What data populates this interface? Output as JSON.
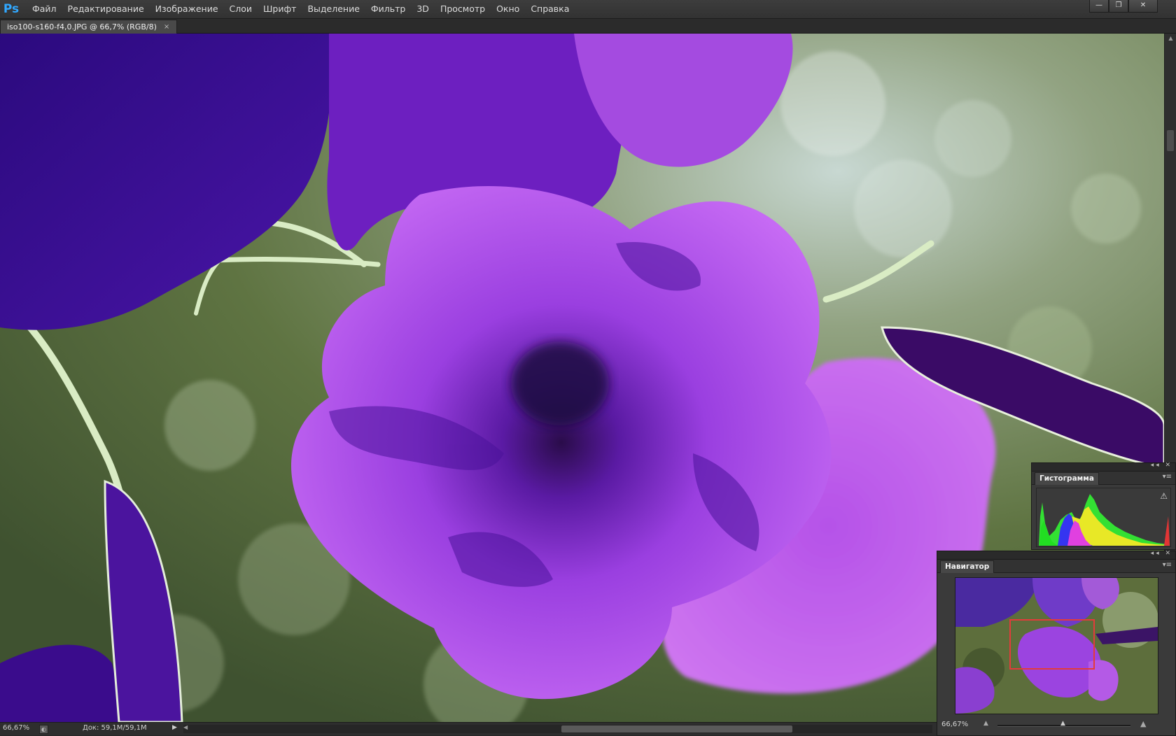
{
  "app": {
    "logo": "Ps"
  },
  "menu": [
    "Файл",
    "Редактирование",
    "Изображение",
    "Слои",
    "Шрифт",
    "Выделение",
    "Фильтр",
    "3D",
    "Просмотр",
    "Окно",
    "Справка"
  ],
  "window_controls": {
    "minimize": "—",
    "restore": "❐",
    "close": "✕"
  },
  "document_tab": {
    "title": "iso100-s160-f4,0.JPG @ 66,7% (RGB/8)",
    "close": "×"
  },
  "status_bar": {
    "zoom": "66,67%",
    "doc_info": "Док: 59,1M/59,1M"
  },
  "histogram_panel": {
    "title": "Гистограмма",
    "warning_icon": "warning-icon"
  },
  "navigator_panel": {
    "title": "Навигатор",
    "zoom": "66,67%"
  },
  "colors": {
    "ui_background": "#262626",
    "menu_bar": "#353535",
    "panel": "#3a3a3a",
    "navigator_view_box": "#e23b3b",
    "photo_petal": "#a346e6",
    "photo_background": "#5f7442"
  }
}
